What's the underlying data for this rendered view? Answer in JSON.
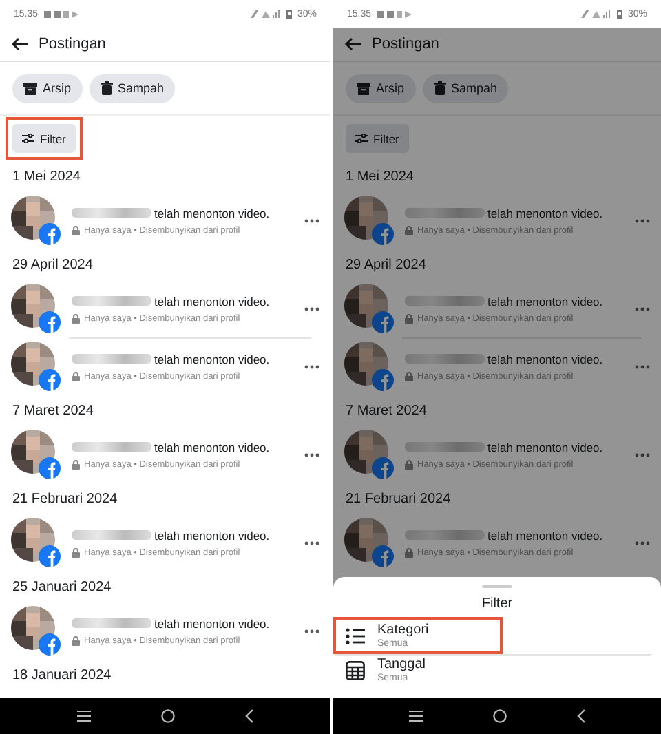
{
  "screens": [
    {
      "status_bar": {
        "time": "15.35",
        "battery": "30%"
      },
      "header": {
        "title": "Postingan"
      },
      "chips": [
        {
          "label": "Arsip",
          "kind": "archive"
        },
        {
          "label": "Sampah",
          "kind": "trash"
        }
      ],
      "filter": {
        "label": "Filter",
        "highlighted": true
      },
      "groups": [
        {
          "date": "1 Mei 2024",
          "posts": [
            {
              "action": "telah menonton video.",
              "meta": "Hanya saya • Disembunyikan dari profil"
            }
          ]
        },
        {
          "date": "29 April 2024",
          "posts": [
            {
              "action": "telah menonton video.",
              "meta": "Hanya saya • Disembunyikan dari profil"
            },
            {
              "action": "telah menonton video.",
              "meta": "Hanya saya • Disembunyikan dari profil"
            }
          ]
        },
        {
          "date": "7 Maret 2024",
          "posts": [
            {
              "action": "telah menonton video.",
              "meta": "Hanya saya • Disembunyikan dari profil"
            }
          ]
        },
        {
          "date": "21 Februari 2024",
          "posts": [
            {
              "action": "telah menonton video.",
              "meta": "Hanya saya • Disembunyikan dari profil"
            }
          ]
        },
        {
          "date": "25 Januari 2024",
          "posts": [
            {
              "action": "telah menonton video.",
              "meta": "Hanya saya • Disembunyikan dari profil"
            }
          ]
        },
        {
          "date": "18 Januari 2024"
        }
      ]
    },
    {
      "status_bar": {
        "time": "15.35",
        "battery": "30%"
      },
      "header": {
        "title": "Postingan"
      },
      "chips": [
        {
          "label": "Arsip",
          "kind": "archive"
        },
        {
          "label": "Sampah",
          "kind": "trash"
        }
      ],
      "filter": {
        "label": "Filter",
        "highlighted": false
      },
      "groups": [
        {
          "date": "1 Mei 2024",
          "posts": [
            {
              "action": "telah menonton video.",
              "meta": "Hanya saya • Disembunyikan dari profil"
            }
          ]
        },
        {
          "date": "29 April 2024",
          "posts": [
            {
              "action": "telah menonton video.",
              "meta": "Hanya saya • Disembunyikan dari profil"
            },
            {
              "action": "telah menonton video.",
              "meta": "Hanya saya • Disembunyikan dari profil"
            }
          ]
        },
        {
          "date": "7 Maret 2024",
          "posts": [
            {
              "action": "telah menonton video.",
              "meta": "Hanya saya • Disembunyikan dari profil"
            }
          ]
        },
        {
          "date": "21 Februari 2024",
          "posts": [
            {
              "action": "telah menonton video.",
              "meta": "Hanya saya • Disembunyikan dari profil"
            }
          ]
        }
      ],
      "sheet": {
        "title": "Filter",
        "items": [
          {
            "label": "Kategori",
            "value": "Semua",
            "kind": "list",
            "highlighted": true
          },
          {
            "label": "Tanggal",
            "value": "Semua",
            "kind": "calendar",
            "highlighted": false
          }
        ]
      }
    }
  ]
}
